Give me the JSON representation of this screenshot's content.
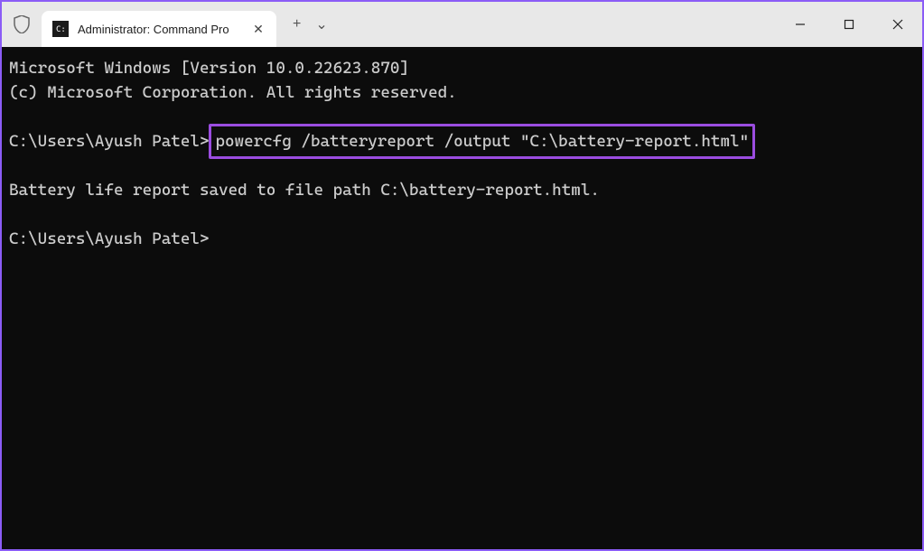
{
  "titlebar": {
    "tab_title": "Administrator: Command Pro",
    "tab_close": "✕",
    "new_tab": "+",
    "dropdown": "⌄"
  },
  "window_controls": {
    "minimize": "—",
    "maximize": "▢",
    "close": "✕"
  },
  "terminal": {
    "line1": "Microsoft Windows [Version 10.0.22623.870]",
    "line2": "(c) Microsoft Corporation. All rights reserved.",
    "prompt1": "C:\\Users\\Ayush Patel>",
    "command1": "powercfg /batteryreport /output \"C:\\battery-report.html\"",
    "output1": "Battery life report saved to file path C:\\battery-report.html.",
    "prompt2": "C:\\Users\\Ayush Patel>"
  }
}
